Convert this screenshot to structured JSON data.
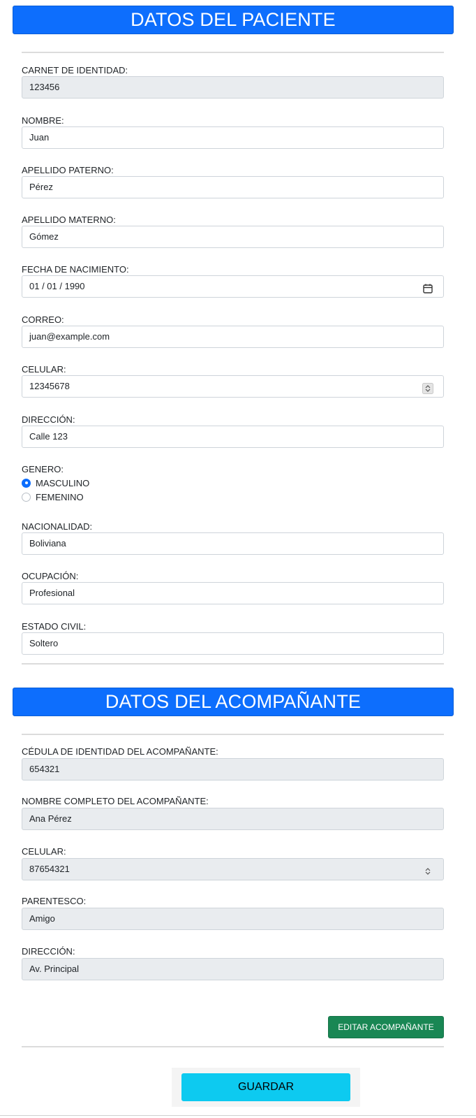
{
  "patient": {
    "header": "DATOS DEL PACIENTE",
    "fields": [
      {
        "label": "CARNET DE IDENTIDAD:",
        "value": "123456"
      },
      {
        "label": "NOMBRE:",
        "value": "Juan"
      },
      {
        "label": "APELLIDO PATERNO:",
        "value": "Pérez"
      },
      {
        "label": "APELLIDO MATERNO:",
        "value": "Gómez"
      },
      {
        "label": "FECHA DE NACIMIENTO:",
        "value": "01 / 01 / 1990"
      },
      {
        "label": "CORREO:",
        "value": "juan@example.com"
      },
      {
        "label": "CELULAR:",
        "value": "12345678"
      },
      {
        "label": "DIRECCIÓN:",
        "value": "Calle 123"
      }
    ],
    "gender": {
      "label": "GENERO:",
      "options": [
        "MASCULINO",
        "FEMENINO"
      ],
      "selected": "MASCULINO"
    },
    "fields2": [
      {
        "label": "NACIONALIDAD:",
        "value": "Boliviana"
      },
      {
        "label": "OCUPACIÓN:",
        "value": "Profesional"
      },
      {
        "label": "ESTADO CIVIL:",
        "value": "Soltero"
      }
    ]
  },
  "companion": {
    "header": "DATOS DEL ACOMPAÑANTE",
    "fields": [
      {
        "label": "CÉDULA DE IDENTIDAD DEL ACOMPAÑANTE:",
        "value": "654321"
      },
      {
        "label": "NOMBRE COMPLETO DEL ACOMPAÑANTE:",
        "value": "Ana Pérez"
      },
      {
        "label": "CELULAR:",
        "value": "87654321"
      },
      {
        "label": "PARENTESCO:",
        "value": "Amigo"
      },
      {
        "label": "DIRECCIÓN:",
        "value": "Av. Principal"
      }
    ],
    "edit_button": "EDITAR ACOMPAÑANTE"
  },
  "save_button": "GUARDAR",
  "icons": {
    "date_field": "calendar-icon",
    "patient_phone": "spinner-icon",
    "companion_phone": "spinner-icon"
  },
  "colors": {
    "header_blue": "#0d6efd",
    "edit_green": "#198754",
    "save_cyan": "#0dcaf0",
    "readonly_gray": "#e9ecef"
  }
}
